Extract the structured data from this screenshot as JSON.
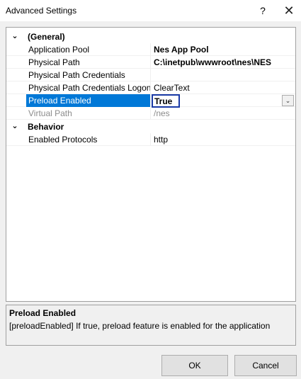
{
  "window": {
    "title": "Advanced Settings",
    "help_label": "?",
    "close_label": "✕"
  },
  "grid": {
    "categories": [
      {
        "label": "(General)",
        "toggle": "⌄"
      },
      {
        "label": "Behavior",
        "toggle": "⌄"
      }
    ],
    "properties": [
      {
        "name": "Application Pool",
        "value": "Nes App Pool"
      },
      {
        "name": "Physical Path",
        "value": "C:\\inetpub\\wwwroot\\nes\\NES"
      },
      {
        "name": "Physical Path Credentials",
        "value": ""
      },
      {
        "name": "Physical Path Credentials Logon",
        "value": "ClearText"
      },
      {
        "name": "Preload Enabled",
        "value": "True"
      },
      {
        "name": "Virtual Path",
        "value": "/nes"
      },
      {
        "name": "Enabled Protocols",
        "value": "http"
      }
    ],
    "dropdown_icon": "chevron-down-icon",
    "dropdown_glyph": "⌄"
  },
  "description": {
    "title": "Preload Enabled",
    "text": "[preloadEnabled] If true, preload feature is enabled for the application"
  },
  "buttons": {
    "ok": "OK",
    "cancel": "Cancel"
  },
  "colors": {
    "selection": "#0078d7",
    "edit_border": "#1a3aa6",
    "disabled_text": "#8c8c8c"
  }
}
